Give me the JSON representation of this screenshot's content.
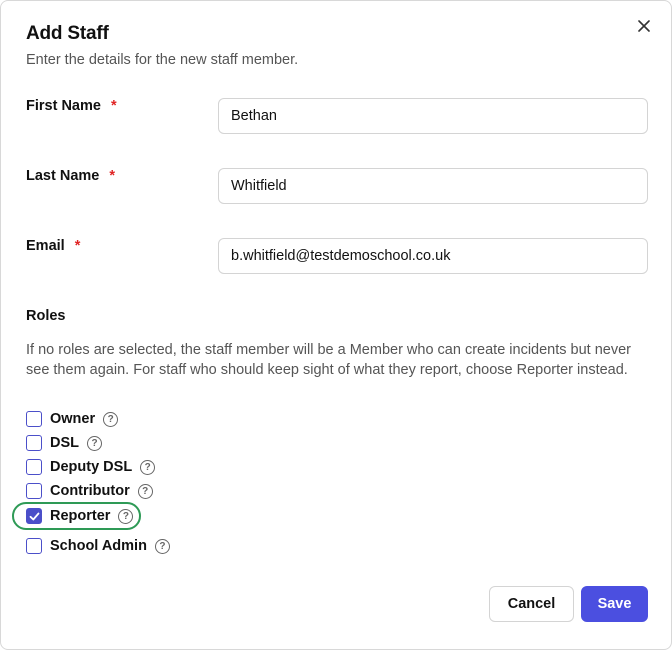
{
  "dialog": {
    "title": "Add Staff",
    "subtitle": "Enter the details for the new staff member."
  },
  "fields": {
    "first_name": {
      "label": "First Name",
      "required_mark": "*",
      "value": "Bethan"
    },
    "last_name": {
      "label": "Last Name",
      "required_mark": "*",
      "value": "Whitfield"
    },
    "email": {
      "label": "Email",
      "required_mark": "*",
      "value": "b.whitfield@testdemoschool.co.uk"
    }
  },
  "roles": {
    "heading": "Roles",
    "help_text": "If no roles are selected, the staff member will be a Member who can create incidents but never see them again. For staff who should keep sight of what they report, choose Reporter instead.",
    "items": [
      {
        "label": "Owner",
        "checked": false
      },
      {
        "label": "DSL",
        "checked": false
      },
      {
        "label": "Deputy DSL",
        "checked": false
      },
      {
        "label": "Contributor",
        "checked": false
      },
      {
        "label": "Reporter",
        "checked": true
      },
      {
        "label": "School Admin",
        "checked": false
      }
    ],
    "help_glyph": "?"
  },
  "actions": {
    "cancel_label": "Cancel",
    "save_label": "Save"
  },
  "colors": {
    "accent": "#4b4fe0",
    "required": "#e02424",
    "highlight": "#2e9a56"
  },
  "icons": {
    "close": "close-icon",
    "help": "help-circle-icon",
    "check": "check-icon"
  }
}
